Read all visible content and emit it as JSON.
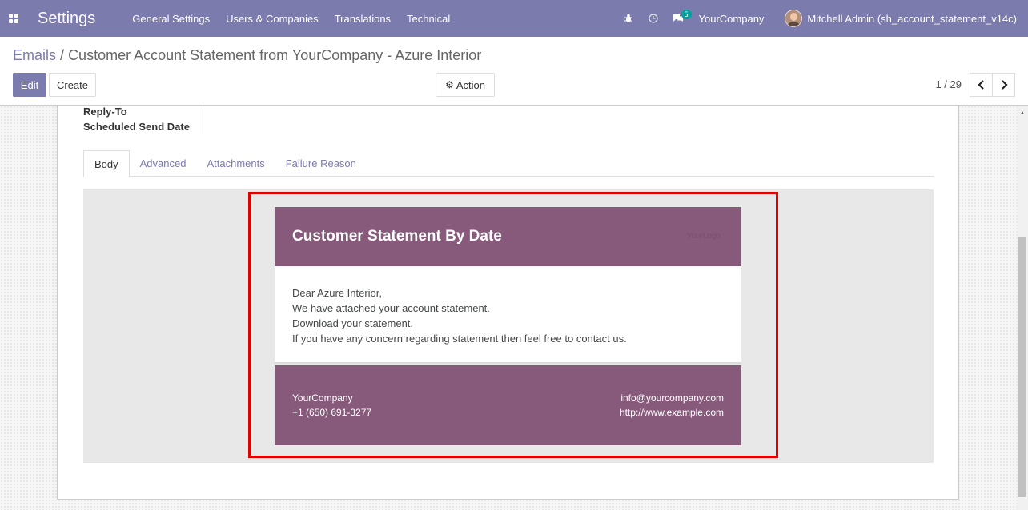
{
  "navbar": {
    "app_title": "Settings",
    "menu": [
      "General Settings",
      "Users & Companies",
      "Translations",
      "Technical"
    ],
    "message_count": "5",
    "company": "YourCompany",
    "user": "Mitchell Admin (sh_account_statement_v14c)"
  },
  "control": {
    "breadcrumb_parent": "Emails",
    "breadcrumb_sep": "/",
    "breadcrumb_current": "Customer Account Statement from YourCompany - Azure Interior",
    "edit_label": "Edit",
    "create_label": "Create",
    "action_label": "Action",
    "pager": "1 / 29"
  },
  "form": {
    "fields": [
      "Reply-To",
      "Scheduled Send Date"
    ],
    "tabs": [
      "Body",
      "Advanced",
      "Attachments",
      "Failure Reason"
    ],
    "active_tab": "Body"
  },
  "mail": {
    "title": "Customer Statement By Date",
    "logo_text": "YourLogo",
    "body_lines": [
      "Dear Azure Interior,",
      "We have attached your account statement.",
      "Download your statement.",
      "If you have any concern regarding statement then feel free to contact us."
    ],
    "footer_company": "YourCompany",
    "footer_phone": "+1 (650) 691-3277",
    "footer_email": "info@yourcompany.com",
    "footer_website": "http://www.example.com"
  },
  "colors": {
    "navbar": "#7c7bad",
    "mail_brand": "#875a7b",
    "highlight": "#e10000"
  }
}
